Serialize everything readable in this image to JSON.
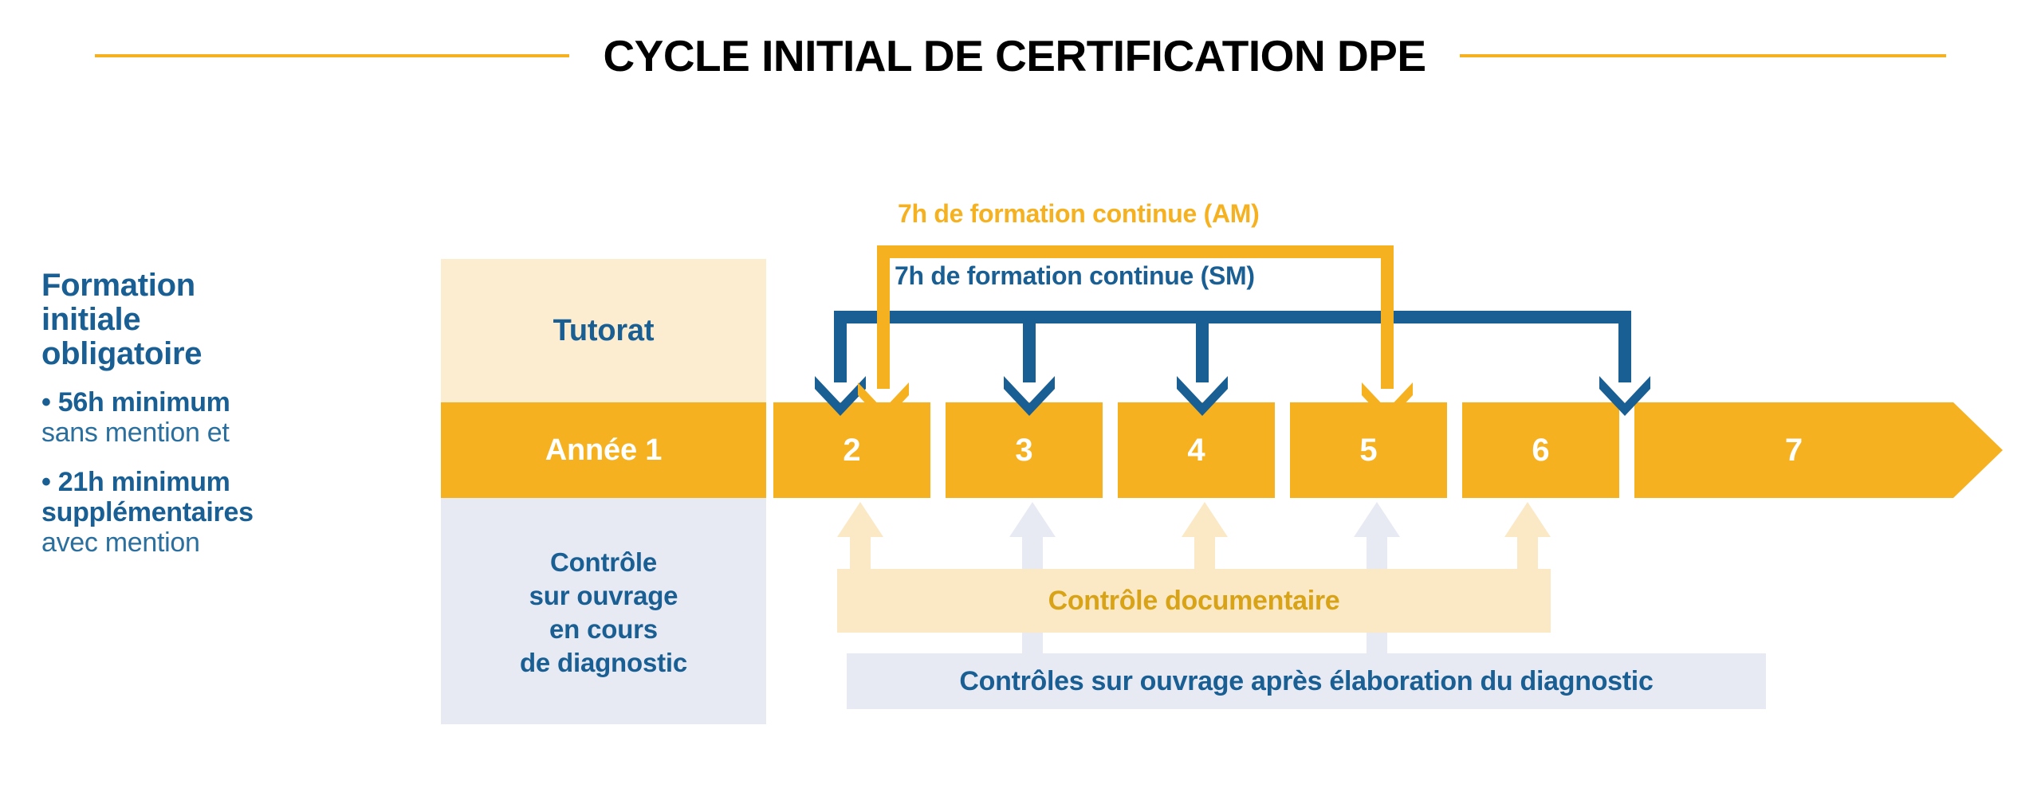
{
  "title": "CYCLE INITIAL DE CERTIFICATION DPE",
  "colors": {
    "accent_yellow": "#f5b120",
    "accent_blue": "#1a5f93",
    "band_light_yellow": "#fbe8c4",
    "band_cream": "#fcecd0",
    "band_light_gray": "#e7eaf3",
    "doc_text_yellow": "#d9a318"
  },
  "left_column": {
    "heading_lines": [
      "Formation",
      "initiale",
      "obligatoire"
    ],
    "bullets": [
      {
        "strong": "• 56h minimum",
        "light": "sans mention et"
      },
      {
        "strong": "• 21h minimum",
        "strong2": "supplémentaires",
        "light": "avec mention"
      }
    ]
  },
  "stack": {
    "tutorat": "Tutorat",
    "annee": "Année 1",
    "controle_lines": [
      "Contrôle",
      "sur ouvrage",
      "en cours",
      "de diagnostic"
    ]
  },
  "timeline": {
    "years": [
      "2",
      "3",
      "4",
      "5",
      "6"
    ],
    "final_year": "7"
  },
  "top_labels": {
    "am": "7h de formation continue (AM)",
    "sm": "7h de formation continue (SM)"
  },
  "bottom_bands": {
    "documentaire": "Contrôle documentaire",
    "ouvrage": "Contrôles sur ouvrage après élaboration du diagnostic"
  }
}
